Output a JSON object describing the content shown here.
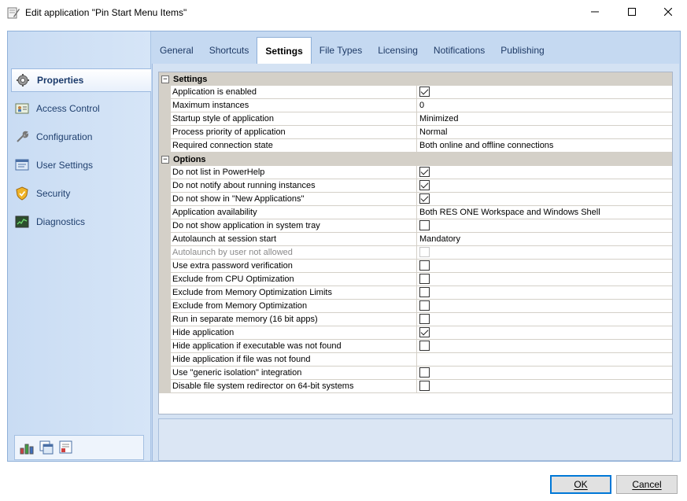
{
  "window": {
    "title": "Edit application \"Pin Start Menu Items\"",
    "icon": "edit-app-icon"
  },
  "sidebar": {
    "items": [
      {
        "label": "Properties",
        "icon": "gear-icon",
        "active": true
      },
      {
        "label": "Access Control",
        "icon": "access-control-icon",
        "active": false
      },
      {
        "label": "Configuration",
        "icon": "wrench-icon",
        "active": false
      },
      {
        "label": "User Settings",
        "icon": "user-settings-icon",
        "active": false
      },
      {
        "label": "Security",
        "icon": "shield-icon",
        "active": false
      },
      {
        "label": "Diagnostics",
        "icon": "diagnostics-icon",
        "active": false
      }
    ],
    "tools": [
      "chart-tool-icon",
      "window-tool-icon",
      "report-tool-icon"
    ]
  },
  "tabs": [
    {
      "label": "General",
      "active": false
    },
    {
      "label": "Shortcuts",
      "active": false
    },
    {
      "label": "Settings",
      "active": true
    },
    {
      "label": "File Types",
      "active": false
    },
    {
      "label": "Licensing",
      "active": false
    },
    {
      "label": "Notifications",
      "active": false
    },
    {
      "label": "Publishing",
      "active": false
    }
  ],
  "grid": {
    "categories": [
      {
        "label": "Settings",
        "rows": [
          {
            "name": "Application is enabled",
            "type": "check",
            "checked": true
          },
          {
            "name": "Maximum instances",
            "type": "text",
            "value": "0"
          },
          {
            "name": "Startup style of application",
            "type": "text",
            "value": "Minimized"
          },
          {
            "name": "Process priority of application",
            "type": "text",
            "value": "Normal"
          },
          {
            "name": "Required connection state",
            "type": "text",
            "value": "Both online and offline connections"
          }
        ]
      },
      {
        "label": "Options",
        "rows": [
          {
            "name": "Do not list in PowerHelp",
            "type": "check",
            "checked": true
          },
          {
            "name": "Do not notify about running instances",
            "type": "check",
            "checked": true
          },
          {
            "name": "Do not show in \"New Applications\"",
            "type": "check",
            "checked": true
          },
          {
            "name": "Application availability",
            "type": "text",
            "value": "Both RES ONE Workspace and Windows Shell"
          },
          {
            "name": "Do not show application in system tray",
            "type": "check",
            "checked": false
          },
          {
            "name": "Autolaunch at session start",
            "type": "text",
            "value": "Mandatory"
          },
          {
            "name": "Autolaunch by user not allowed",
            "type": "check",
            "checked": false,
            "disabled": true
          },
          {
            "name": "Use extra password verification",
            "type": "check",
            "checked": false
          },
          {
            "name": "Exclude from CPU Optimization",
            "type": "check",
            "checked": false
          },
          {
            "name": "Exclude from Memory Optimization Limits",
            "type": "check",
            "checked": false
          },
          {
            "name": "Exclude from Memory Optimization",
            "type": "check",
            "checked": false
          },
          {
            "name": "Run in separate memory (16 bit apps)",
            "type": "check",
            "checked": false
          },
          {
            "name": "Hide application",
            "type": "check",
            "checked": true
          },
          {
            "name": "Hide application if executable was not found",
            "type": "check",
            "checked": false
          },
          {
            "name": "Hide application if file was not found",
            "type": "empty"
          },
          {
            "name": "Use \"generic isolation\" integration",
            "type": "check",
            "checked": false
          },
          {
            "name": "Disable file system redirector on 64-bit systems",
            "type": "check",
            "checked": false
          }
        ]
      }
    ]
  },
  "buttons": {
    "ok_label": "OK",
    "cancel_label": "Cancel"
  }
}
